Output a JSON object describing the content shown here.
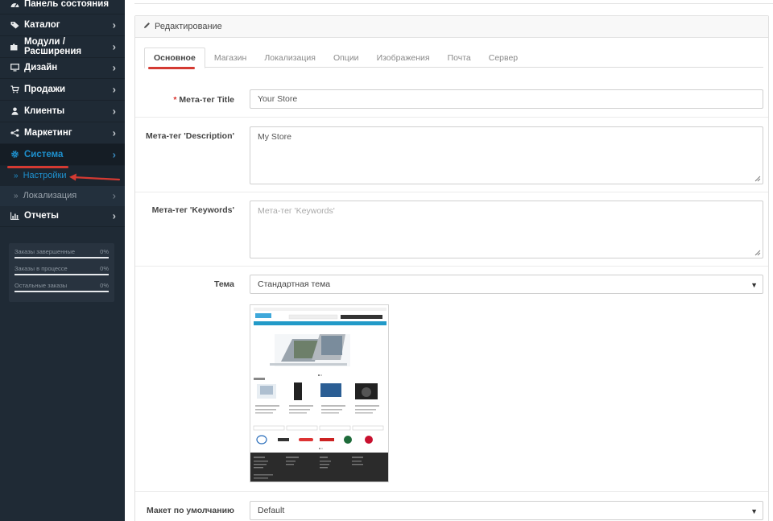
{
  "sidebar": {
    "items": [
      {
        "label": "Панель состояния",
        "icon": "dashboard-icon"
      },
      {
        "label": "Каталог",
        "icon": "tag-icon"
      },
      {
        "label": "Модули / Расширения",
        "icon": "puzzle-icon"
      },
      {
        "label": "Дизайн",
        "icon": "desktop-icon"
      },
      {
        "label": "Продажи",
        "icon": "cart-icon"
      },
      {
        "label": "Клиенты",
        "icon": "user-icon"
      },
      {
        "label": "Маркетинг",
        "icon": "share-icon"
      },
      {
        "label": "Система",
        "icon": "gear-icon"
      }
    ],
    "subitems": [
      {
        "label": "Настройки"
      },
      {
        "label": "Локализация"
      }
    ],
    "reports": {
      "label": "Отчеты",
      "icon": "bar-chart-icon"
    },
    "stats": [
      {
        "label": "Заказы завершенные",
        "value": "0%"
      },
      {
        "label": "Заказы в процессе",
        "value": "0%"
      },
      {
        "label": "Остальные заказы",
        "value": "0%"
      }
    ]
  },
  "panel": {
    "heading": "Редактирование",
    "tabs": [
      {
        "label": "Основное"
      },
      {
        "label": "Магазин"
      },
      {
        "label": "Локализация"
      },
      {
        "label": "Опции"
      },
      {
        "label": "Изображения"
      },
      {
        "label": "Почта"
      },
      {
        "label": "Сервер"
      }
    ]
  },
  "form": {
    "meta_title": {
      "required_mark": "*",
      "label": "Мета-тег Title",
      "value": "Your Store"
    },
    "meta_description": {
      "label": "Мета-тег 'Description'",
      "value": "My Store"
    },
    "meta_keywords": {
      "label": "Мета-тег 'Keywords'",
      "placeholder": "Мета-тег 'Keywords'"
    },
    "theme": {
      "label": "Тема",
      "value": "Стандартная тема"
    },
    "layout": {
      "label": "Макет по умолчанию",
      "value": "Default"
    }
  },
  "colors": {
    "accent": "#1e91cf",
    "annotation": "#d43a32",
    "sidebar": "#1f2a35"
  }
}
